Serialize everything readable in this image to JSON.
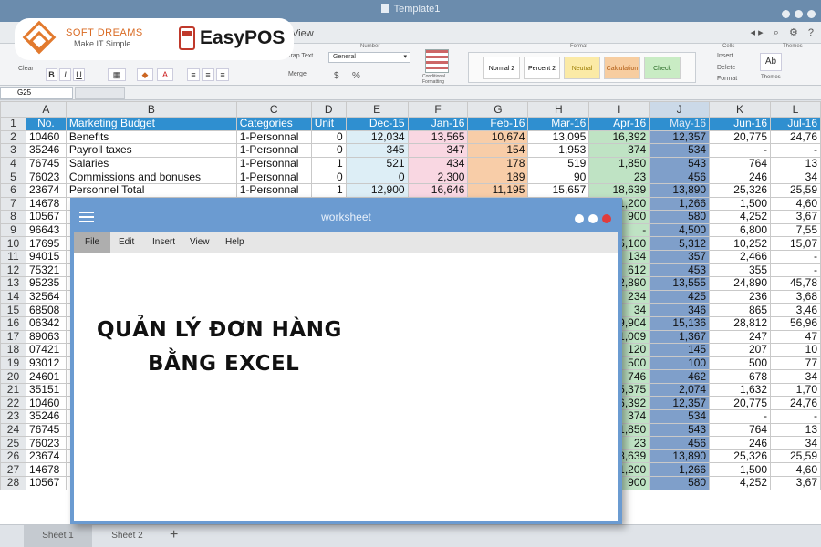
{
  "window": {
    "title": "Template1"
  },
  "ribbon": {
    "view_tab": "View",
    "group_number": "Number",
    "group_format": "Format",
    "group_cells": "Cells",
    "group_themes": "Themes",
    "clear_label": "Clear",
    "wrap_text": "Wrap Text",
    "merge": "Merge",
    "number_format": "General",
    "currency": "$",
    "percent": "%",
    "conditional_formatting": "Conditional Formatting",
    "styles": [
      "Normal 2",
      "Percent 2",
      "Neutral",
      "Calculation",
      "Check"
    ],
    "insert": "Insert",
    "delete": "Delete",
    "format": "Format",
    "themes": "Themes"
  },
  "formula_bar": {
    "name_box": "G25"
  },
  "sheet": {
    "columns": [
      "A",
      "B",
      "C",
      "D",
      "E",
      "F",
      "G",
      "H",
      "I",
      "J",
      "K",
      "L"
    ],
    "header": [
      "No.",
      "Marketing Budget",
      "Categories",
      "Unit",
      "Dec-15",
      "Jan-16",
      "Feb-16",
      "Mar-16",
      "Apr-16",
      "May-16",
      "Jun-16",
      "Jul-16"
    ],
    "rows": [
      [
        "10460",
        "Benefits",
        "1-Personnal",
        "0",
        "12,034",
        "13,565",
        "10,674",
        "13,095",
        "16,392",
        "12,357",
        "20,775",
        "24,76"
      ],
      [
        "35246",
        "Payroll taxes",
        "1-Personnal",
        "0",
        "345",
        "347",
        "154",
        "1,953",
        "374",
        "534",
        "-",
        "-"
      ],
      [
        "76745",
        "Salaries",
        "1-Personnal",
        "1",
        "521",
        "434",
        "178",
        "519",
        "1,850",
        "543",
        "764",
        "13"
      ],
      [
        "76023",
        "Commissions and bonuses",
        "1-Personnal",
        "0",
        "0",
        "2,300",
        "189",
        "90",
        "23",
        "456",
        "246",
        "34"
      ],
      [
        "23674",
        "Personnel Total",
        "1-Personnal",
        "1",
        "12,900",
        "16,646",
        "11,195",
        "15,657",
        "18,639",
        "13,890",
        "25,326",
        "25,59"
      ],
      [
        "14678",
        "",
        "",
        "",
        "",
        "",
        "",
        "",
        "1,200",
        "1,266",
        "1,500",
        "4,60"
      ],
      [
        "10567",
        "",
        "",
        "",
        "",
        "",
        "",
        "",
        "900",
        "580",
        "4,252",
        "3,67"
      ],
      [
        "96643",
        "",
        "",
        "",
        "",
        "",
        "",
        "",
        "-",
        "4,500",
        "6,800",
        "7,55"
      ],
      [
        "17695",
        "",
        "",
        "",
        "",
        "",
        "",
        "",
        "5,100",
        "5,312",
        "10,252",
        "15,07"
      ],
      [
        "94015",
        "",
        "",
        "",
        "",
        "",
        "",
        "",
        "134",
        "357",
        "2,466",
        "-"
      ],
      [
        "75321",
        "",
        "",
        "",
        "",
        "",
        "",
        "",
        "612",
        "453",
        "355",
        "-"
      ],
      [
        "95235",
        "",
        "",
        "",
        "",
        "",
        "",
        "",
        "2,890",
        "13,555",
        "24,890",
        "45,78"
      ],
      [
        "32564",
        "",
        "",
        "",
        "",
        "",
        "",
        "",
        "234",
        "425",
        "236",
        "3,68"
      ],
      [
        "68508",
        "",
        "",
        "",
        "",
        "",
        "",
        "",
        "34",
        "346",
        "865",
        "3,46"
      ],
      [
        "06342",
        "",
        "",
        "",
        "",
        "",
        "",
        "",
        "9,904",
        "15,136",
        "28,812",
        "56,96"
      ],
      [
        "89063",
        "",
        "",
        "",
        "",
        "",
        "",
        "",
        "1,009",
        "1,367",
        "247",
        "47"
      ],
      [
        "07421",
        "",
        "",
        "",
        "",
        "",
        "",
        "",
        "120",
        "145",
        "207",
        "10"
      ],
      [
        "93012",
        "",
        "",
        "",
        "",
        "",
        "",
        "",
        "500",
        "100",
        "500",
        "77"
      ],
      [
        "24601",
        "",
        "",
        "",
        "",
        "",
        "",
        "",
        "746",
        "462",
        "678",
        "34"
      ],
      [
        "35151",
        "",
        "",
        "",
        "",
        "",
        "",
        "",
        "5,375",
        "2,074",
        "1,632",
        "1,70"
      ],
      [
        "10460",
        "",
        "",
        "",
        "",
        "",
        "",
        "",
        "6,392",
        "12,357",
        "20,775",
        "24,76"
      ],
      [
        "35246",
        "",
        "",
        "",
        "",
        "",
        "",
        "",
        "374",
        "534",
        "-",
        "-"
      ],
      [
        "76745",
        "",
        "",
        "",
        "",
        "",
        "",
        "",
        "1,850",
        "543",
        "764",
        "13"
      ],
      [
        "76023",
        "",
        "",
        "",
        "",
        "",
        "",
        "",
        "23",
        "456",
        "246",
        "34"
      ],
      [
        "23674",
        "",
        "",
        "",
        "",
        "",
        "",
        "",
        "8,639",
        "13,890",
        "25,326",
        "25,59"
      ],
      [
        "14678",
        "",
        "",
        "",
        "",
        "",
        "",
        "",
        "1,200",
        "1,266",
        "1,500",
        "4,60"
      ],
      [
        "10567",
        "",
        "",
        "",
        "",
        "",
        "",
        "",
        "900",
        "580",
        "4,252",
        "3,67"
      ]
    ]
  },
  "sheet_tabs": [
    "Sheet 1",
    "Sheet 2"
  ],
  "add_sheet": "+",
  "logos": {
    "softdreams_name": "SOFT DREAMS",
    "softdreams_tagline": "Make IT Simple",
    "easypos_name": "EasyPOS"
  },
  "worksheet_window": {
    "title": "worksheet",
    "menu": [
      "File",
      "Edit",
      "Insert",
      "View",
      "Help"
    ],
    "headline_line1": "QUẢN LÝ ĐƠN HÀNG",
    "headline_line2": "BẰNG EXCEL"
  },
  "colors": {
    "header_blue": "#2f8fd0",
    "window_blue": "#6b9bd1",
    "brand_orange": "#e27a2e",
    "brand_red": "#c0392b"
  }
}
